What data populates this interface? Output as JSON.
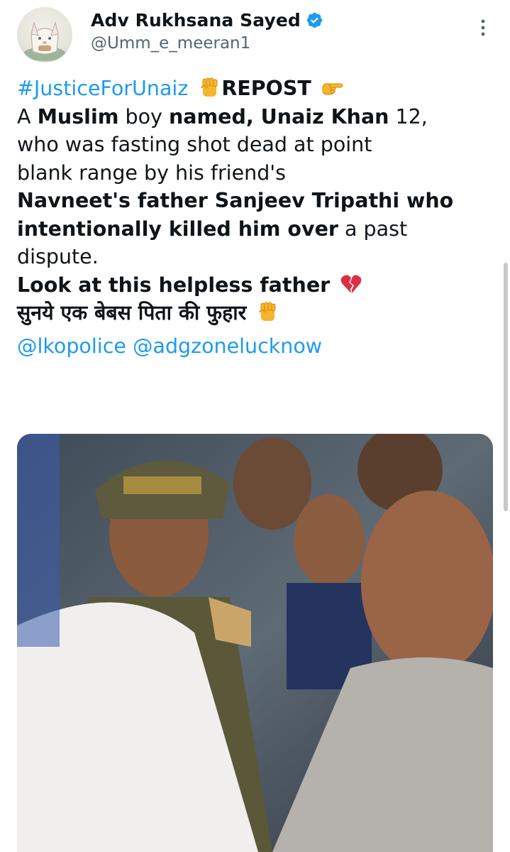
{
  "author": {
    "display_name": "Adv Rukhsana Sayed",
    "handle": "@Umm_e_meeran1"
  },
  "tweet": {
    "line1": {
      "hashtag": "#JusticeForUnaiz",
      "repost": "REPOST"
    },
    "line2": {
      "t1": "A ",
      "b1": "Muslim",
      "t2": " boy ",
      "b2": "named, Unaiz Khan",
      "t3": " 12,"
    },
    "line3": "who was fasting shot dead at point",
    "line4": "blank range by his friend's",
    "line5": "Navneet's father Sanjeev Tripathi who",
    "line6": {
      "b1": "intentionally killed him over",
      "t1": " a past"
    },
    "line7": "dispute.",
    "line8": "Look at this helpless father",
    "line9": "सुनये एक बेबस पिता की फुहार",
    "mentions": {
      "m1": "@lkopolice",
      "m2": "@adgzonelucknow"
    }
  },
  "icons": {
    "verified": "verified-badge-icon",
    "more": "more-options-icon",
    "fist": "raised-fist-emoji",
    "pointing": "pointing-right-emoji",
    "broken_heart": "broken-heart-emoji"
  },
  "colors": {
    "link": "#1d9bf0",
    "text": "#0f1419",
    "secondary": "#536471"
  }
}
